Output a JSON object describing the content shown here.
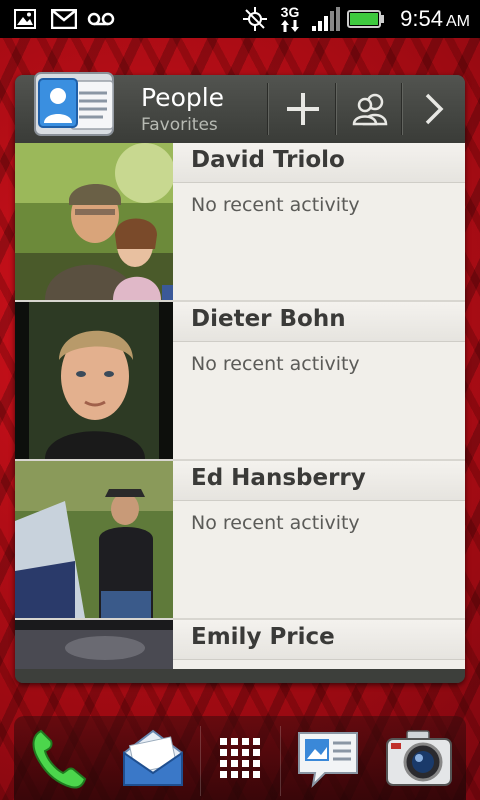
{
  "status_bar": {
    "time": "9:54",
    "ampm": "AM",
    "network_type": "3G",
    "icons": [
      "gallery-notification-icon",
      "gmail-icon",
      "voicemail-icon",
      "gps-icon",
      "network-3g-icon",
      "signal-icon",
      "battery-icon"
    ]
  },
  "widget": {
    "title": "People",
    "subtitle": "Favorites",
    "actions": [
      "add-contact",
      "groups",
      "next"
    ]
  },
  "contacts": [
    {
      "name": "David Triolo",
      "activity": "No recent activity"
    },
    {
      "name": "Dieter Bohn",
      "activity": "No recent activity"
    },
    {
      "name": "Ed Hansberry",
      "activity": "No recent activity"
    },
    {
      "name": "Emily Price",
      "activity": ""
    }
  ],
  "colors": {
    "wallpaper": "#c4101a",
    "widget_frame": "#3d3f3b",
    "list_bg": "#f1efea",
    "battery": "#3ec93e"
  },
  "dock": {
    "items": [
      "phone-icon",
      "mail-icon",
      "all-apps-icon",
      "messages-icon",
      "camera-icon"
    ]
  }
}
